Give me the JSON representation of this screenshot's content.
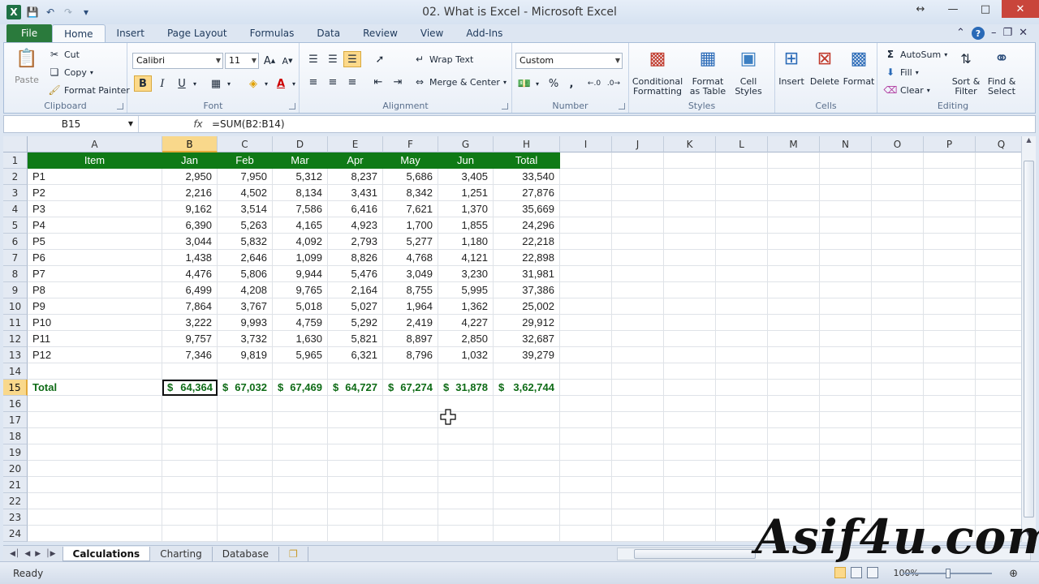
{
  "window": {
    "title": "02. What is Excel  -  Microsoft Excel",
    "app_icon": "X"
  },
  "ribbon_tabs": [
    "File",
    "Home",
    "Insert",
    "Page Layout",
    "Formulas",
    "Data",
    "Review",
    "View",
    "Add-Ins"
  ],
  "active_tab": "Home",
  "ribbon": {
    "clipboard": {
      "label": "Clipboard",
      "paste": "Paste",
      "cut": "Cut",
      "copy": "Copy",
      "format_painter": "Format Painter"
    },
    "font": {
      "label": "Font",
      "name": "Calibri",
      "size": "11"
    },
    "alignment": {
      "label": "Alignment",
      "wrap_text": "Wrap Text",
      "merge_center": "Merge & Center"
    },
    "number": {
      "label": "Number",
      "format": "Custom"
    },
    "styles": {
      "label": "Styles",
      "conditional_1": "Conditional",
      "conditional_2": "Formatting",
      "format_table_1": "Format",
      "format_table_2": "as Table",
      "cell_styles_1": "Cell",
      "cell_styles_2": "Styles"
    },
    "cells": {
      "label": "Cells",
      "insert": "Insert",
      "delete": "Delete",
      "format": "Format"
    },
    "editing": {
      "label": "Editing",
      "autosum": "AutoSum",
      "fill": "Fill",
      "clear": "Clear",
      "sort_1": "Sort &",
      "sort_2": "Filter",
      "find_1": "Find &",
      "find_2": "Select"
    }
  },
  "formula_bar": {
    "name_box": "B15",
    "fx": "fx",
    "formula": "=SUM(B2:B14)"
  },
  "columns": [
    "A",
    "B",
    "C",
    "D",
    "E",
    "F",
    "G",
    "H",
    "I",
    "J",
    "K",
    "L",
    "M",
    "N",
    "O",
    "P",
    "Q"
  ],
  "selected_column": "B",
  "rows": [
    "1",
    "2",
    "3",
    "4",
    "5",
    "6",
    "7",
    "8",
    "9",
    "10",
    "11",
    "12",
    "13",
    "14",
    "15",
    "16",
    "17",
    "18",
    "19",
    "20",
    "21",
    "22",
    "23",
    "24"
  ],
  "selected_row": "15",
  "table": {
    "headers": [
      "Item",
      "Jan",
      "Feb",
      "Mar",
      "Apr",
      "May",
      "Jun",
      "Total"
    ],
    "data": [
      [
        "P1",
        "2,950",
        "7,950",
        "5,312",
        "8,237",
        "5,686",
        "3,405",
        "33,540"
      ],
      [
        "P2",
        "2,216",
        "4,502",
        "8,134",
        "3,431",
        "8,342",
        "1,251",
        "27,876"
      ],
      [
        "P3",
        "9,162",
        "3,514",
        "7,586",
        "6,416",
        "7,621",
        "1,370",
        "35,669"
      ],
      [
        "P4",
        "6,390",
        "5,263",
        "4,165",
        "4,923",
        "1,700",
        "1,855",
        "24,296"
      ],
      [
        "P5",
        "3,044",
        "5,832",
        "4,092",
        "2,793",
        "5,277",
        "1,180",
        "22,218"
      ],
      [
        "P6",
        "1,438",
        "2,646",
        "1,099",
        "8,826",
        "4,768",
        "4,121",
        "22,898"
      ],
      [
        "P7",
        "4,476",
        "5,806",
        "9,944",
        "5,476",
        "3,049",
        "3,230",
        "31,981"
      ],
      [
        "P8",
        "6,499",
        "4,208",
        "9,765",
        "2,164",
        "8,755",
        "5,995",
        "37,386"
      ],
      [
        "P9",
        "7,864",
        "3,767",
        "5,018",
        "5,027",
        "1,964",
        "1,362",
        "25,002"
      ],
      [
        "P10",
        "3,222",
        "9,993",
        "4,759",
        "5,292",
        "2,419",
        "4,227",
        "29,912"
      ],
      [
        "P11",
        "9,757",
        "3,732",
        "1,630",
        "5,821",
        "8,897",
        "2,850",
        "32,687"
      ],
      [
        "P12",
        "7,346",
        "9,819",
        "5,965",
        "6,321",
        "8,796",
        "1,032",
        "39,279"
      ]
    ],
    "total_label": "Total",
    "currency": "$",
    "totals": [
      "64,364",
      "67,032",
      "67,469",
      "64,727",
      "67,274",
      "31,878",
      "3,62,744"
    ]
  },
  "sheets": [
    "Calculations",
    "Charting",
    "Database"
  ],
  "active_sheet": "Calculations",
  "status": {
    "ready": "Ready",
    "zoom": "100%"
  },
  "watermark": "Asif4u.com",
  "colors": {
    "header_green": "#0f7a16",
    "total_green": "#0e6b16",
    "selection": "#f9d88b",
    "file_tab": "#2a7a3c"
  }
}
